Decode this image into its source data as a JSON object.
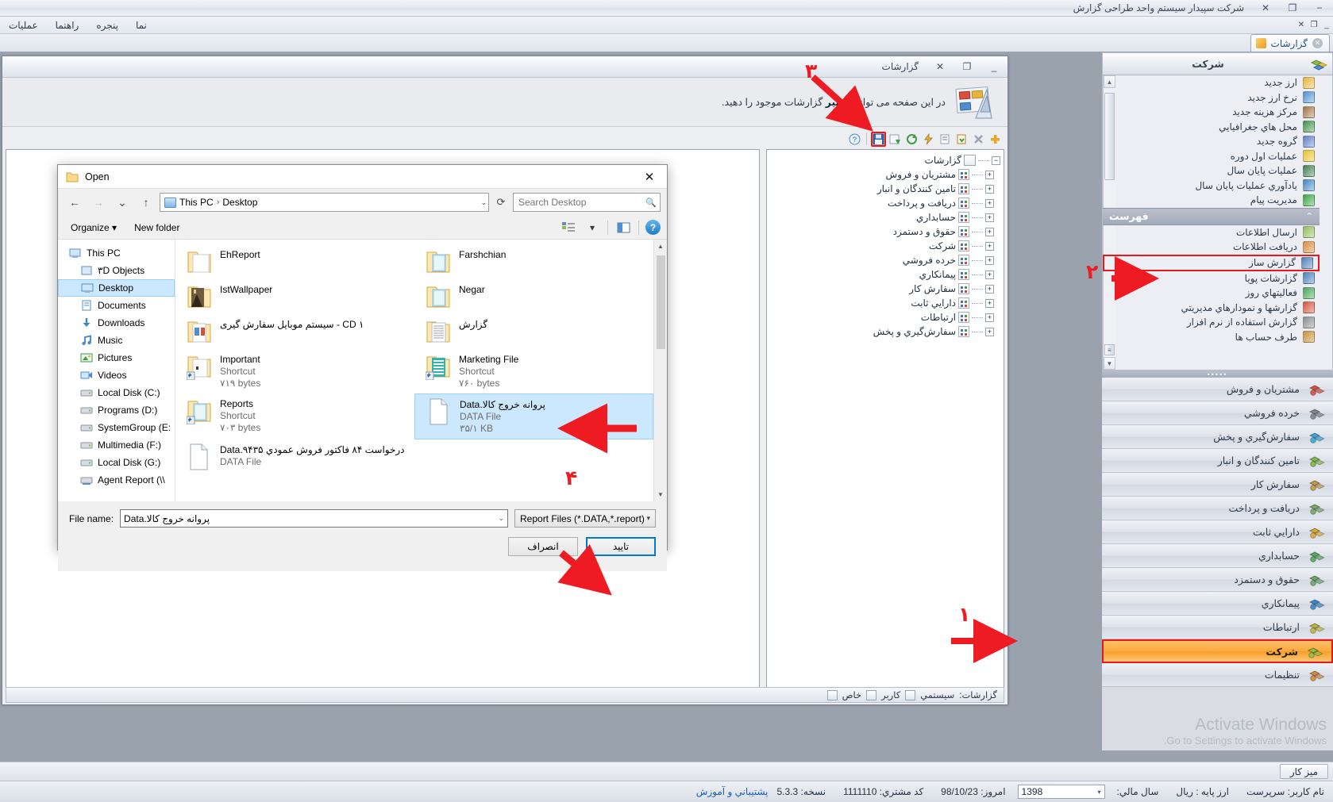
{
  "app": {
    "title": "شرکت سپیدار سیستم واحد طراحی گزارش",
    "min": "−",
    "restore": "❐",
    "close": "✕"
  },
  "menu": {
    "items": [
      {
        "label": "پنجره"
      },
      {
        "label": "راهنما"
      },
      {
        "label": "عملیات"
      },
      {
        "label": "نما"
      }
    ],
    "mdi": {
      "close": "✕",
      "restore": "❐",
      "min": "_"
    }
  },
  "tabs": [
    {
      "label": "گزارشات",
      "close": "✕"
    }
  ],
  "report_window": {
    "title": "گزارشات",
    "btn_close": "✕",
    "btn_restore": "❐",
    "btn_min": "_",
    "banner_prefix": "در این صفحه می توانید",
    "banner_bold": "تغییر",
    "banner_mid": "گزارشات موجود را",
    "banner_suffix": "دهید.",
    "toolbar": [
      {
        "name": "add-report",
        "glyph": "✚"
      },
      {
        "name": "delete-report",
        "glyph": "✕"
      },
      {
        "name": "new-report",
        "glyph": "🗋"
      },
      {
        "name": "edit-report",
        "glyph": "✎"
      },
      {
        "name": "run-report",
        "glyph": "⚡"
      },
      {
        "name": "group-report",
        "glyph": "❖"
      },
      {
        "name": "import-report",
        "glyph": "⇩"
      },
      {
        "name": "open-report",
        "glyph": "💾"
      },
      {
        "name": "help-report",
        "glyph": "?"
      }
    ],
    "tree": {
      "root": "گزارشات",
      "nodes": [
        "مشتریان و فروش",
        "تامین کنندگان و انبار",
        "دریافت و پرداخت",
        "حسابداري",
        "حقوق و دستمزد",
        "شرکت",
        "خرده فروشي",
        "پیمانکاري",
        "سفارش کار",
        "دارایي ثابت",
        "ارتباطات",
        "سفارش‌گیري و پخش"
      ]
    },
    "status": {
      "label": "گزارشات:",
      "system": "سیستمي",
      "user": "کاربر",
      "custom": "خاص"
    }
  },
  "sidebar": {
    "header": "شرکت",
    "top_items": [
      {
        "label": "ارز جدید",
        "color": "#e8b33c"
      },
      {
        "label": "نرخ ارز جدید",
        "color": "#4d8fd1"
      },
      {
        "label": "مرکز هزینه جدید",
        "color": "#a07444"
      },
      {
        "label": "محل هاي جغرافیایي",
        "color": "#3f8e46"
      },
      {
        "label": "گروه جدید",
        "color": "#5d7fc4"
      },
      {
        "label": "عملیات اول دوره",
        "color": "#e4c12f"
      },
      {
        "label": "عملیات پایان سال",
        "color": "#3e7c4b"
      },
      {
        "label": "یادآوري عملیات پایان سال",
        "color": "#3f86c4"
      },
      {
        "label": "مدیریت پیام",
        "color": "#36a53f"
      }
    ],
    "group_title": "فهرست",
    "group_chevron": "⌃",
    "menu_items": [
      {
        "label": "ارسال اطلاعات",
        "color": "#8fbf5e"
      },
      {
        "label": "دریافت اطلاعات",
        "color": "#d98b3d"
      },
      {
        "label": "گزارش ساز",
        "color": "#4d7fb8",
        "highlight": true
      },
      {
        "label": "گزارشات پویا",
        "color": "#4d7fb8"
      },
      {
        "label": "فعالیتهاي روز",
        "color": "#49a55a"
      },
      {
        "label": "گزارشها و نمودارهاي مدیریتي",
        "color": "#d3553f"
      },
      {
        "label": "گزارش استفاده از نرم افزار",
        "color": "#8d8d8d"
      },
      {
        "label": "طرف حساب ها",
        "color": "#c7913a"
      }
    ],
    "nav_items": [
      {
        "label": "مشتریان و فروش",
        "color": "#d94f3c"
      },
      {
        "label": "خرده فروشي",
        "color": "#7d8690"
      },
      {
        "label": "سفارش‌گیري و پخش",
        "color": "#39a7d8"
      },
      {
        "label": "تامین کنندگان و انبار",
        "color": "#7dbb43"
      },
      {
        "label": "سفارش کار",
        "color": "#c79a42"
      },
      {
        "label": "دریافت و پرداخت",
        "color": "#79a86a"
      },
      {
        "label": "دارایي ثابت",
        "color": "#e0a92f"
      },
      {
        "label": "حسابداري",
        "color": "#58a85e"
      },
      {
        "label": "حقوق و دستمزد",
        "color": "#6ea86a"
      },
      {
        "label": "پیمانکاري",
        "color": "#3a86c8"
      },
      {
        "label": "ارتباطات",
        "color": "#c0b83a"
      },
      {
        "label": "شرکت",
        "color": "#8fbf4a",
        "selected": true
      },
      {
        "label": "تنظیمات",
        "color": "#d08b3a"
      }
    ]
  },
  "watermark": {
    "line1": "Activate Windows",
    "line2": "Go to Settings to activate Windows."
  },
  "taskbar": {
    "items": [
      {
        "label": "میز کار"
      }
    ]
  },
  "statusbar": {
    "support_link": "پشتیباني و آموزش",
    "username_label": "نام کاربر:",
    "username_value": "سرپرست",
    "fiscal_label": "سال مالي:",
    "fiscal_value": "1398",
    "fiscal_arrow": "▾",
    "currency_label": "ارز پایه :",
    "currency_value": "ریال",
    "today_label": "امروز:",
    "today_value": "98/10/23",
    "customer_label": "کد مشتري:",
    "customer_value": "1111110",
    "version_label": "نسخه:",
    "version_value": "5.3.3"
  },
  "dialog": {
    "title": "Open",
    "close": "✕",
    "nav": {
      "back": "←",
      "forward": "→",
      "recent": "⌄",
      "up": "↑",
      "refresh": "⟳"
    },
    "breadcrumb": {
      "root": "This PC",
      "sep": "›",
      "current": "Desktop",
      "arrow": "⌄"
    },
    "search": {
      "placeholder": "Search Desktop",
      "value": "",
      "icon": "🔍"
    },
    "toolbar": {
      "organize": "Organize",
      "organize_arrow": "▾",
      "new_folder": "New folder",
      "view_icon": "▤",
      "view_arrow": "▾",
      "pane_icon": "◫",
      "help": "?"
    },
    "places": [
      {
        "label": "This PC",
        "level": 1,
        "kind": "pc"
      },
      {
        "label": "۳D Objects",
        "level": 2,
        "kind": "folder3d"
      },
      {
        "label": "Desktop",
        "level": 2,
        "kind": "desktop",
        "selected": true
      },
      {
        "label": "Documents",
        "level": 2,
        "kind": "documents"
      },
      {
        "label": "Downloads",
        "level": 2,
        "kind": "downloads"
      },
      {
        "label": "Music",
        "level": 2,
        "kind": "music"
      },
      {
        "label": "Pictures",
        "level": 2,
        "kind": "pictures"
      },
      {
        "label": "Videos",
        "level": 2,
        "kind": "videos"
      },
      {
        "label": "Local Disk (C:)",
        "level": 2,
        "kind": "drive"
      },
      {
        "label": "Programs (D:)",
        "level": 2,
        "kind": "drive"
      },
      {
        "label": "SystemGroup (E:",
        "level": 2,
        "kind": "drive"
      },
      {
        "label": "Multimedia (F:)",
        "level": 2,
        "kind": "drive"
      },
      {
        "label": "Local Disk (G:)",
        "level": 2,
        "kind": "drive"
      },
      {
        "label": "Agent Report (\\\\",
        "level": 2,
        "kind": "network"
      }
    ],
    "files": [
      [
        {
          "name": "EhReport",
          "type": "folder",
          "sub1": "",
          "sub2": "",
          "rtl": false
        },
        {
          "name": "Farshchian",
          "type": "folder-img",
          "sub1": "",
          "sub2": "",
          "rtl": false
        }
      ],
      [
        {
          "name": "IstWallpaper",
          "type": "folder-photo",
          "sub1": "",
          "sub2": "",
          "rtl": false
        },
        {
          "name": "Negar",
          "type": "folder-img",
          "sub1": "",
          "sub2": "",
          "rtl": false
        }
      ],
      [
        {
          "name": "CD ۱ - سیستم موبایل سفارش گیری",
          "type": "folder-cd",
          "sub1": "",
          "sub2": "",
          "rtl": true
        },
        {
          "name": "گزارش",
          "type": "folder-doc",
          "sub1": "",
          "sub2": "",
          "rtl": true
        }
      ],
      [
        {
          "name": "Important",
          "type": "shortcut-folder",
          "sub1": "Shortcut",
          "sub2": "۷۱۹ bytes",
          "rtl": false
        },
        {
          "name": "Marketing File",
          "type": "shortcut-folder-green",
          "sub1": "Shortcut",
          "sub2": "۷۶۰ bytes",
          "rtl": false
        }
      ],
      [
        {
          "name": "Reports",
          "type": "shortcut-folder-blue",
          "sub1": "Shortcut",
          "sub2": "۷۰۳ bytes",
          "rtl": false
        },
        {
          "name": "پروانه خروج کالا.Data",
          "type": "datafile",
          "sub1": "DATA File",
          "sub2": "۳۵/۱ KB",
          "rtl": true,
          "selected": true
        }
      ],
      [
        {
          "name": "درخواست ۸۴ فاکتور فروش عمودي ۹۴۳۵.Data",
          "type": "datafile",
          "sub1": "DATA File",
          "sub2": "",
          "rtl": true
        },
        {
          "name": "",
          "type": "none",
          "sub1": "",
          "sub2": "",
          "rtl": false
        }
      ]
    ],
    "footer": {
      "filename_label": "File name:",
      "filename_value": "پروانه خروج کالا.Data",
      "filename_arrow": "⌄",
      "filter_value": "Report Files (*.DATA,*.report)",
      "filter_arrow": "▾",
      "ok": "تایید",
      "cancel": "انصراف"
    }
  },
  "annotations": [
    {
      "id": "1",
      "num": "۱"
    },
    {
      "id": "2",
      "num": "۲"
    },
    {
      "id": "3",
      "num": "۳"
    },
    {
      "id": "4",
      "num": "۴"
    }
  ]
}
